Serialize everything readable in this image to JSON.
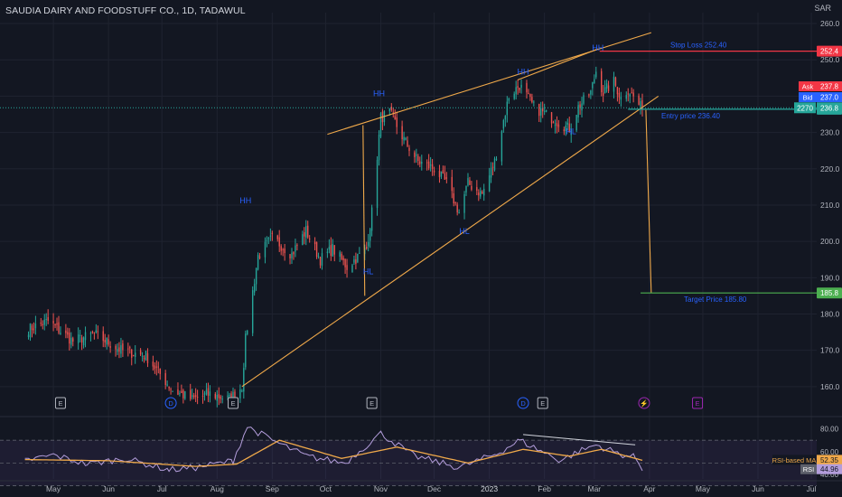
{
  "header": {
    "title": "SAUDIA DAIRY AND FOODSTUFF CO., 1D, TADAWUL",
    "currency": "SAR"
  },
  "colors": {
    "background": "#131722",
    "up": "#26a69a",
    "down": "#ef5350",
    "trendline": "#f0a94a",
    "pivot_label": "#2962ff",
    "stop_line": "#f23645",
    "entry_line": "#26a69a",
    "target_line": "#4caf50",
    "rsi_line": "#b39ddb",
    "rsi_ma": "#f0a94a",
    "grid": "#1f2330"
  },
  "chart_data": [
    {
      "type": "candlestick",
      "interval": "1D",
      "y_axis_ticks": [
        160.0,
        170.0,
        180.0,
        190.0,
        200.0,
        210.0,
        220.0,
        230.0,
        240.0,
        250.0,
        260.0
      ],
      "ylim": [
        152,
        263
      ],
      "x_axis_labels": [
        "May",
        "Jun",
        "Jul",
        "Aug",
        "Sep",
        "Oct",
        "Nov",
        "Dec",
        "2023",
        "Feb",
        "Mar",
        "Apr",
        "May",
        "Jun",
        "Jul"
      ],
      "price_anchors": [
        {
          "date": "2022-04-15",
          "price": 175.5
        },
        {
          "date": "2022-04-28",
          "price": 178.0
        },
        {
          "date": "2022-05-12",
          "price": 172.5
        },
        {
          "date": "2022-05-24",
          "price": 174.5
        },
        {
          "date": "2022-06-08",
          "price": 170.0
        },
        {
          "date": "2022-06-22",
          "price": 168.5
        },
        {
          "date": "2022-07-07",
          "price": 159.0
        },
        {
          "date": "2022-07-18",
          "price": 156.5
        },
        {
          "date": "2022-07-28",
          "price": 158.0
        },
        {
          "date": "2022-08-08",
          "price": 156.5
        },
        {
          "date": "2022-08-15",
          "price": 160.0
        },
        {
          "date": "2022-08-17",
          "price": 173.0
        },
        {
          "date": "2022-08-24",
          "price": 196.0
        },
        {
          "date": "2022-09-01",
          "price": 201.0
        },
        {
          "date": "2022-09-12",
          "price": 196.5
        },
        {
          "date": "2022-09-20",
          "price": 203.0
        },
        {
          "date": "2022-09-28",
          "price": 195.0
        },
        {
          "date": "2022-10-05",
          "price": 198.0
        },
        {
          "date": "2022-10-13",
          "price": 193.0
        },
        {
          "date": "2022-10-24",
          "price": 198.0
        },
        {
          "date": "2022-10-27",
          "price": 208.0
        },
        {
          "date": "2022-11-01",
          "price": 234.0
        },
        {
          "date": "2022-11-06",
          "price": 235.5
        },
        {
          "date": "2022-11-14",
          "price": 228.0
        },
        {
          "date": "2022-11-22",
          "price": 222.0
        },
        {
          "date": "2022-12-01",
          "price": 220.0
        },
        {
          "date": "2022-12-08",
          "price": 216.0
        },
        {
          "date": "2022-12-15",
          "price": 208.0
        },
        {
          "date": "2022-12-20",
          "price": 216.0
        },
        {
          "date": "2022-12-28",
          "price": 213.0
        },
        {
          "date": "2023-01-04",
          "price": 222.0
        },
        {
          "date": "2023-01-12",
          "price": 240.0
        },
        {
          "date": "2023-01-18",
          "price": 243.0
        },
        {
          "date": "2023-01-26",
          "price": 237.0
        },
        {
          "date": "2023-02-05",
          "price": 234.0
        },
        {
          "date": "2023-02-15",
          "price": 231.0
        },
        {
          "date": "2023-02-20",
          "price": 237.0
        },
        {
          "date": "2023-02-27",
          "price": 241.0
        },
        {
          "date": "2023-03-02",
          "price": 247.0
        },
        {
          "date": "2023-03-06",
          "price": 241.0
        },
        {
          "date": "2023-03-12",
          "price": 244.0
        },
        {
          "date": "2023-03-16",
          "price": 239.5
        },
        {
          "date": "2023-03-20",
          "price": 242.0
        },
        {
          "date": "2023-03-24",
          "price": 239.0
        },
        {
          "date": "2023-03-28",
          "price": 236.4
        }
      ],
      "pivot_labels": [
        {
          "text": "HH",
          "date": "2022-08-17",
          "price": 210.5
        },
        {
          "text": "HL",
          "date": "2022-10-25",
          "price": 191.0
        },
        {
          "text": "HH",
          "date": "2022-10-31",
          "price": 240.0
        },
        {
          "text": "HL",
          "date": "2022-12-18",
          "price": 202.0
        },
        {
          "text": "HH",
          "date": "2023-01-20",
          "price": 246.0
        },
        {
          "text": "HH",
          "date": "2023-03-03",
          "price": 252.5
        },
        {
          "text": "HL",
          "date": "2023-02-16",
          "price": 229.5
        }
      ],
      "trendlines": [
        {
          "role": "wedge upper",
          "points": [
            {
              "date": "2022-10-02",
              "price": 229.5
            },
            {
              "date": "2023-04-02",
              "price": 257.5
            }
          ]
        },
        {
          "role": "wedge lower",
          "points": [
            {
              "date": "2022-08-15",
              "price": 160.0
            },
            {
              "date": "2023-04-06",
              "price": 240.0
            }
          ]
        },
        {
          "role": "wedge height",
          "points": [
            {
              "date": "2022-10-22",
              "price": 232.0
            },
            {
              "date": "2022-10-23",
              "price": 185.0
            }
          ]
        },
        {
          "role": "projection",
          "points": [
            {
              "date": "2023-03-30",
              "price": 236.2
            },
            {
              "date": "2023-04-02",
              "price": 185.8
            }
          ]
        },
        {
          "role": "HH resistance",
          "points": [
            {
              "date": "2023-01-17",
              "price": 244.5
            },
            {
              "date": "2023-03-03",
              "price": 253.0
            }
          ]
        }
      ],
      "levels": [
        {
          "name": "stop",
          "label": "Stop Loss  252.40",
          "price": 252.4,
          "axis_label": "252.4",
          "start": "2023-03-04",
          "color": "#f23645"
        },
        {
          "name": "entry",
          "label": "Entry price  236.40",
          "price": 236.4,
          "axis_label": "236.4",
          "start": "2023-03-20",
          "color": "#26a69a"
        },
        {
          "name": "target",
          "label": "Target Price 185.80",
          "price": 185.8,
          "axis_label": "185.8",
          "start": "2023-03-27",
          "color": "#4caf50"
        }
      ],
      "current_price_line": {
        "price": 236.8,
        "axis_label": "236.8",
        "countdown": "2270"
      },
      "quote_box": [
        {
          "label": "Ask",
          "value": "237.8",
          "color": "#f23645"
        },
        {
          "label": "Bid",
          "value": "237.0",
          "color": "#2962ff"
        }
      ],
      "event_markers": [
        {
          "letter": "E",
          "date": "2022-05-05",
          "color": "#b2b5be"
        },
        {
          "letter": "D",
          "date": "2022-07-06",
          "color": "#2962ff"
        },
        {
          "letter": "E",
          "date": "2022-08-10",
          "color": "#b2b5be"
        },
        {
          "letter": "E",
          "date": "2022-10-27",
          "color": "#b2b5be"
        },
        {
          "letter": "D",
          "date": "2023-01-20",
          "color": "#2962ff"
        },
        {
          "letter": "E",
          "date": "2023-01-31",
          "color": "#b2b5be"
        },
        {
          "letter": "⚡",
          "date": "2023-03-29",
          "color": "#9c27b0"
        },
        {
          "letter": "E",
          "date": "2023-04-28",
          "color": "#9c27b0"
        }
      ]
    },
    {
      "type": "line",
      "panel": "RSI",
      "y_axis_ticks": [
        40.0,
        60.0,
        80.0
      ],
      "ylim": [
        36,
        90
      ],
      "bands": [
        70,
        50,
        30
      ],
      "series": [
        {
          "name": "RSI",
          "value_label": "44.96",
          "values": [
            {
              "date": "2022-04-15",
              "value": 52
            },
            {
              "date": "2022-05-01",
              "value": 57
            },
            {
              "date": "2022-05-20",
              "value": 49
            },
            {
              "date": "2022-06-10",
              "value": 54
            },
            {
              "date": "2022-07-05",
              "value": 44
            },
            {
              "date": "2022-07-20",
              "value": 46
            },
            {
              "date": "2022-08-10",
              "value": 52
            },
            {
              "date": "2022-08-18",
              "value": 82
            },
            {
              "date": "2022-09-01",
              "value": 70
            },
            {
              "date": "2022-09-20",
              "value": 56
            },
            {
              "date": "2022-10-12",
              "value": 50
            },
            {
              "date": "2022-11-01",
              "value": 76
            },
            {
              "date": "2022-11-20",
              "value": 56
            },
            {
              "date": "2022-12-15",
              "value": 46
            },
            {
              "date": "2023-01-05",
              "value": 58
            },
            {
              "date": "2023-01-18",
              "value": 70
            },
            {
              "date": "2023-02-10",
              "value": 52
            },
            {
              "date": "2023-02-20",
              "value": 60
            },
            {
              "date": "2023-03-02",
              "value": 66
            },
            {
              "date": "2023-03-15",
              "value": 58
            },
            {
              "date": "2023-03-24",
              "value": 55
            },
            {
              "date": "2023-03-28",
              "value": 44.96
            }
          ]
        },
        {
          "name": "RSI-based MA",
          "value_label": "52.35",
          "values": [
            {
              "date": "2022-04-15",
              "value": 53
            },
            {
              "date": "2022-06-01",
              "value": 52
            },
            {
              "date": "2022-07-20",
              "value": 47
            },
            {
              "date": "2022-08-12",
              "value": 49
            },
            {
              "date": "2022-09-05",
              "value": 70
            },
            {
              "date": "2022-10-10",
              "value": 54
            },
            {
              "date": "2022-11-10",
              "value": 64
            },
            {
              "date": "2022-12-20",
              "value": 50
            },
            {
              "date": "2023-01-20",
              "value": 62
            },
            {
              "date": "2023-02-15",
              "value": 56
            },
            {
              "date": "2023-03-05",
              "value": 62
            },
            {
              "date": "2023-03-28",
              "value": 52.35
            }
          ]
        }
      ],
      "divergence_line": [
        {
          "date": "2023-01-20",
          "value": 75
        },
        {
          "date": "2023-03-24",
          "value": 66
        }
      ]
    }
  ]
}
